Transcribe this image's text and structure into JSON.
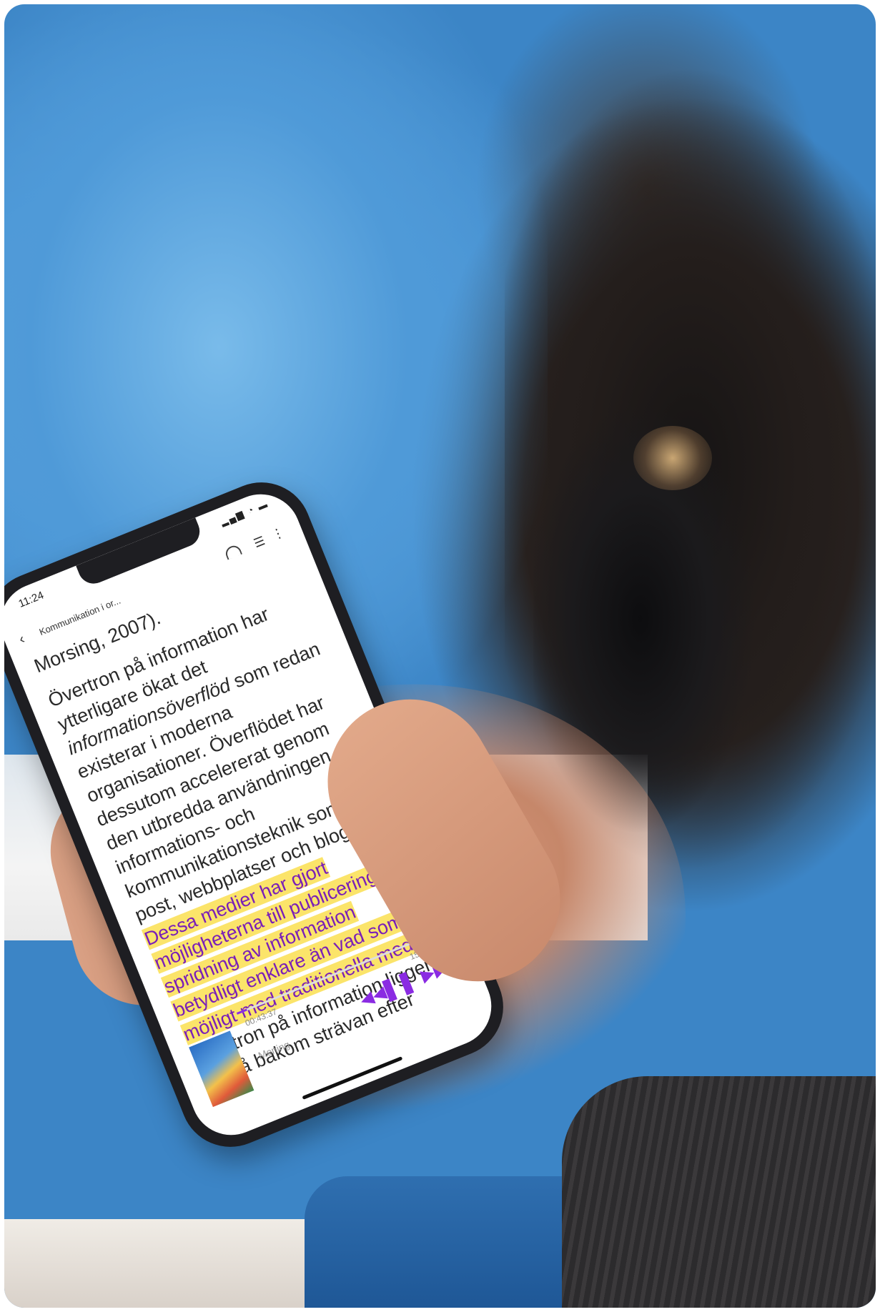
{
  "status": {
    "time": "11:24",
    "icons": "▂▄▆ ◔ ▬"
  },
  "topbar": {
    "title": "Kommunikation i or..."
  },
  "reader": {
    "para1": "Morsing, 2007).",
    "para2_plain": "Övertron på information har ytterligare ökat det ",
    "para2_italic": "informationsöverflöd",
    "para2_rest": " som redan existerar i moderna organisationer. Överflödet har dessutom accelererat genom den utbredda användningen av informations- och kommunikationsteknik som e-post, webbplatser och bloggar. ",
    "highlight": "Dessa medier har gjort möjligheterna till publicering och spridning av information betydligt enklare än vad som är möjligt med traditionella medier.",
    "after": " Övertron på information ligger också bakom strävan efter"
  },
  "player": {
    "position": "00:43:37",
    "end": "15:11:58",
    "mode": "Mening",
    "progress": 0.05,
    "rewind_icon": "◀◀",
    "pause_icon": "❚❚",
    "forward_icon": "▶▶"
  },
  "colors": {
    "accent": "#8a2be2",
    "highlight": "#fbe46a"
  }
}
